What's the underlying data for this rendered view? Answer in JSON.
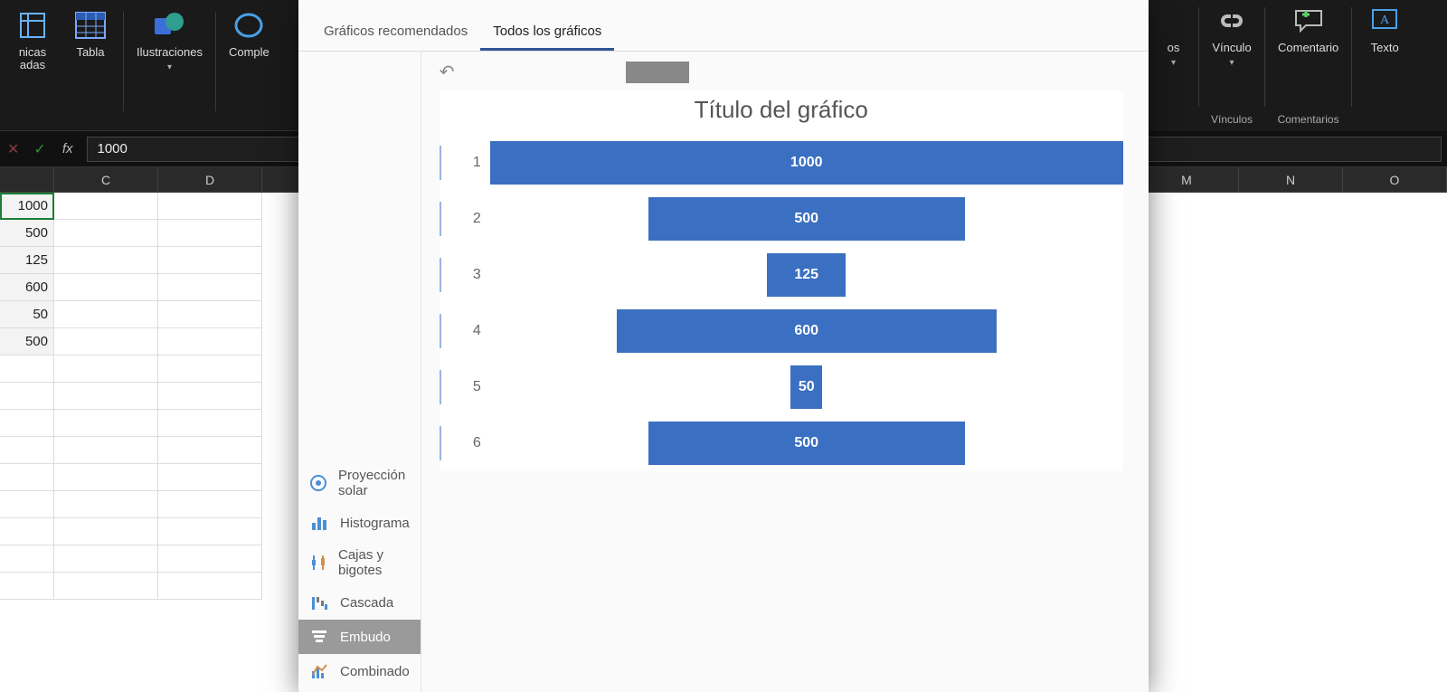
{
  "ribbon": {
    "left_partial_label_line1": "nicas",
    "left_partial_label_line2": "adas",
    "tabla": "Tabla",
    "ilustraciones": "Ilustraciones",
    "complementos_partial": "Comple",
    "vinculo": "Vínculo",
    "comentario": "Comentario",
    "texto_partial": "Texto",
    "partial_os": "os",
    "group_vinculos": "Vínculos",
    "group_comentarios": "Comentarios"
  },
  "formula_bar": {
    "fx": "fx",
    "value": "1000"
  },
  "columns": [
    "",
    "C",
    "D",
    "M",
    "N",
    "O"
  ],
  "cells_colB": [
    "1000",
    "500",
    "125",
    "600",
    "50",
    "500"
  ],
  "dialog": {
    "tabs": {
      "recomendados": "Gráficos recomendados",
      "todos": "Todos los gráficos"
    },
    "chart_types": [
      {
        "label": "Proyección solar",
        "icon": "sun"
      },
      {
        "label": "Histograma",
        "icon": "histogram"
      },
      {
        "label": "Cajas y bigotes",
        "icon": "boxplot"
      },
      {
        "label": "Cascada",
        "icon": "waterfall"
      },
      {
        "label": "Embudo",
        "icon": "funnel",
        "selected": true
      },
      {
        "label": "Combinado",
        "icon": "combo"
      }
    ]
  },
  "chart_data": {
    "type": "bar",
    "title": "Título del gráfico",
    "categories": [
      "1",
      "2",
      "3",
      "4",
      "5",
      "6"
    ],
    "values": [
      1000,
      500,
      125,
      600,
      50,
      500
    ],
    "xlabel": "",
    "ylabel": "",
    "ylim": [
      0,
      1000
    ],
    "bar_color": "#3b6fc1",
    "orientation": "horizontal-centered"
  }
}
